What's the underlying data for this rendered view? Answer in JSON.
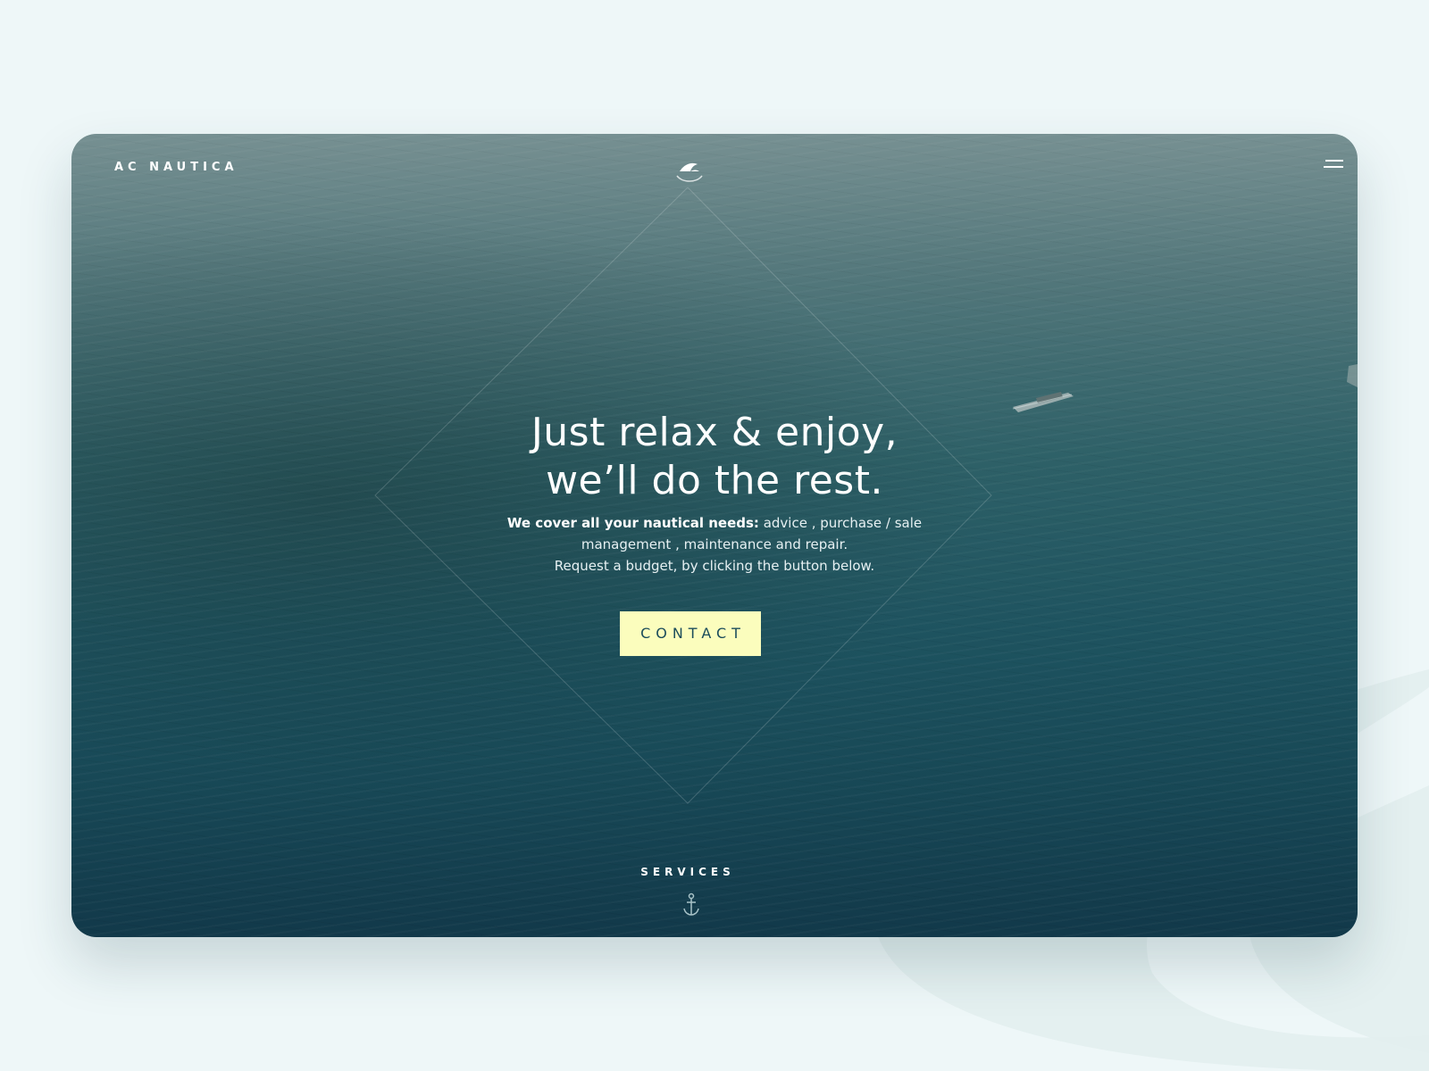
{
  "header": {
    "brand": "AC NAUTICA",
    "logo_icon": "sail-logo-icon",
    "menu_icon": "hamburger-menu-icon"
  },
  "hero": {
    "headline_line1": "Just relax & enjoy,",
    "headline_line2": "we’ll do the rest.",
    "subtext_strong": "We cover all your nautical needs:",
    "subtext_rest": " advice ,  purchase / sale management , maintenance and repair.",
    "subtext_line3": "Request a budget, by clicking the button below.",
    "cta_label": "CONTACT"
  },
  "footer": {
    "services_label": "SERVICES",
    "scroll_icon": "anchor-icon"
  },
  "colors": {
    "page_background": "#eef7f8",
    "sea_dark": "#143f52",
    "sea_mid": "#2f6269",
    "cta_background": "#fbfdbd",
    "cta_text": "#1b4c5b",
    "text": "#ffffff"
  }
}
